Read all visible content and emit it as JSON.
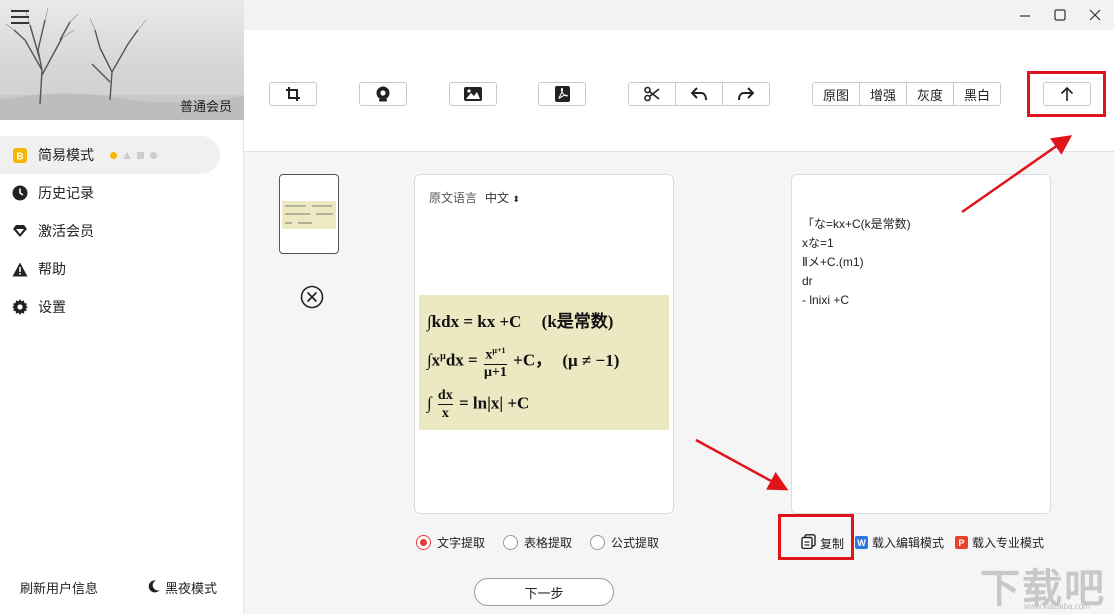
{
  "sidebar": {
    "member_level": "普通会员",
    "items": [
      {
        "label": "简易模式",
        "icon": "b-badge-icon"
      },
      {
        "label": "历史记录",
        "icon": "clock-icon"
      },
      {
        "label": "激活会员",
        "icon": "diamond-icon"
      },
      {
        "label": "帮助",
        "icon": "help-warning-icon"
      },
      {
        "label": "设置",
        "icon": "gear-icon"
      }
    ],
    "refresh_user": "刷新用户信息",
    "night_mode": "黑夜模式"
  },
  "toolbar": {
    "tools": [
      "crop-icon",
      "camera-icon",
      "image-icon",
      "pdf-icon",
      "cut-icon",
      "undo-icon",
      "redo-icon"
    ],
    "filters": [
      "原图",
      "增强",
      "灰度",
      "黑白"
    ],
    "upload_icon": "upload-arrow-icon"
  },
  "source": {
    "lang_label": "原文语言",
    "lang_value": "中文",
    "formula": {
      "line1": "∫kdx = kx  +C",
      "line1_note": "(k是常数)",
      "line2_a": "∫x",
      "line2_sup": "μ",
      "line2_b": "dx =",
      "line2_num": "x",
      "line2_num_sup": "μ+1",
      "line2_den": "μ+1",
      "line2_c": "+C，",
      "line2_note": "(μ ≠ −1)",
      "line3_a": "∫",
      "line3_num": "dx",
      "line3_den": "x",
      "line3_b": "=   ln|x|  +C"
    }
  },
  "result": {
    "text": "「な=kx+C(k是常数)\nxな=1\nⅡメ+C.(m1)\ndr\n- lnixi +C"
  },
  "modes": [
    {
      "label": "文字提取",
      "selected": true
    },
    {
      "label": "表格提取",
      "selected": false
    },
    {
      "label": "公式提取",
      "selected": false
    }
  ],
  "next_button": "下一步",
  "result_actions": {
    "copy": "复制",
    "edit_mode": "载入编辑模式",
    "edit_badge": "W",
    "pro_mode": "载入专业模式",
    "pro_badge": "P"
  },
  "watermark": {
    "text": "下载吧",
    "sub": "www.xiazaiba.com"
  },
  "colors": {
    "accent_red": "#e0141b",
    "mode_yellow": "#f7b500",
    "word_blue": "#2b78e4",
    "ppt_red": "#e8412c"
  }
}
